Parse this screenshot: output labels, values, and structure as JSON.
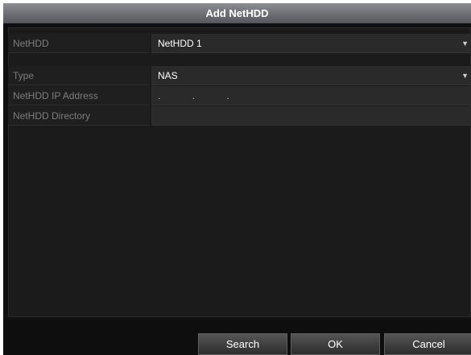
{
  "dialog": {
    "title": "Add NetHDD"
  },
  "fields": {
    "nethdd": {
      "label": "NetHDD",
      "value": "NetHDD 1"
    },
    "type": {
      "label": "Type",
      "value": "NAS"
    },
    "ip_address": {
      "label": "NetHDD IP Address",
      "value": ". . ."
    },
    "directory": {
      "label": "NetHDD Directory",
      "value": ""
    }
  },
  "buttons": {
    "search": "Search",
    "ok": "OK",
    "cancel": "Cancel"
  },
  "icons": {
    "dropdown": "chevron-down-icon"
  }
}
